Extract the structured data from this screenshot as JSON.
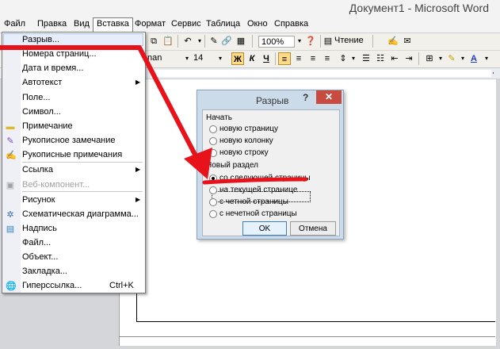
{
  "window": {
    "title": "Документ1 - Microsoft Word"
  },
  "menubar": {
    "items": [
      "Файл",
      "Правка",
      "Вид",
      "Вставка",
      "Формат",
      "Сервис",
      "Таблица",
      "Окно",
      "Справка"
    ]
  },
  "toolbar": {
    "zoom": "100%",
    "read_label": "Чтение",
    "font_name": "nan",
    "font_size": "14",
    "bold": "Ж",
    "italic": "К",
    "underline": "Ч"
  },
  "insert_menu": {
    "items": [
      {
        "label": "Разрыв...",
        "icon": ""
      },
      {
        "label": "Номера страниц...",
        "icon": ""
      },
      {
        "label": "Дата и время...",
        "icon": ""
      },
      {
        "label": "Автотекст",
        "icon": "",
        "submenu": true
      },
      {
        "label": "Поле...",
        "icon": ""
      },
      {
        "label": "Символ...",
        "icon": ""
      },
      {
        "label": "Примечание",
        "icon": "comment-icon"
      },
      {
        "label": "Рукописное замечание",
        "icon": "ink-annotation-icon"
      },
      {
        "label": "Рукописные примечания",
        "icon": "ink-comment-icon"
      },
      {
        "label": "Ссылка",
        "icon": "",
        "submenu": true
      },
      {
        "label": "Веб-компонент...",
        "icon": "web-component-icon",
        "disabled": true
      },
      {
        "label": "Рисунок",
        "icon": "",
        "submenu": true
      },
      {
        "label": "Схематическая диаграмма...",
        "icon": "diagram-icon"
      },
      {
        "label": "Надпись",
        "icon": "textbox-icon"
      },
      {
        "label": "Файл...",
        "icon": ""
      },
      {
        "label": "Объект...",
        "icon": ""
      },
      {
        "label": "Закладка...",
        "icon": ""
      },
      {
        "label": "Гиперссылка...",
        "icon": "hyperlink-icon",
        "shortcut": "Ctrl+K"
      }
    ]
  },
  "dialog": {
    "title": "Разрыв",
    "help": "?",
    "close": "✕",
    "group_start": "Начать",
    "start_options": [
      "новую страницу",
      "новую колонку",
      "новую строку"
    ],
    "group_section": "Новый раздел",
    "section_options": [
      "со следующей страницы",
      "на текущей странице",
      "с четной страницы",
      "с нечетной страницы"
    ],
    "selected": "со следующей страницы",
    "ok": "OK",
    "cancel": "Отмена"
  },
  "colors": {
    "annotation": "#e8121b",
    "dialog_frame": "#ccdbe9",
    "close_button": "#c74c3f"
  }
}
